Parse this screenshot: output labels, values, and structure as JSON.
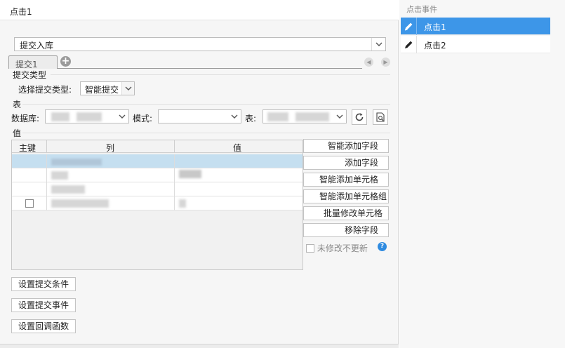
{
  "dialog": {
    "title": "点击1"
  },
  "action": {
    "selected": "提交入库"
  },
  "tabs": [
    {
      "label": "提交1"
    }
  ],
  "submit_type": {
    "section": "提交类型",
    "label": "选择提交类型:",
    "value": "智能提交"
  },
  "table_section": {
    "section": "表",
    "db_label": "数据库:",
    "schema_label": "模式:",
    "table_label": "表:"
  },
  "value_section": {
    "section": "值",
    "columns": [
      "主键",
      "列",
      "值"
    ]
  },
  "side_buttons": [
    "智能添加字段",
    "添加字段",
    "智能添加单元格",
    "智能添加单元格组",
    "批量修改单元格",
    "移除字段"
  ],
  "unchanged_option": "未修改不更新",
  "bottom_buttons": [
    "设置提交条件",
    "设置提交事件",
    "设置回调函数"
  ],
  "events_panel": {
    "title": "点击事件",
    "items": [
      {
        "label": "点击1",
        "selected": true
      },
      {
        "label": "点击2",
        "selected": false
      }
    ]
  },
  "colors": {
    "selection": "#3d96e8",
    "row_selected": "#c5dff0",
    "help": "#2f8be0"
  }
}
